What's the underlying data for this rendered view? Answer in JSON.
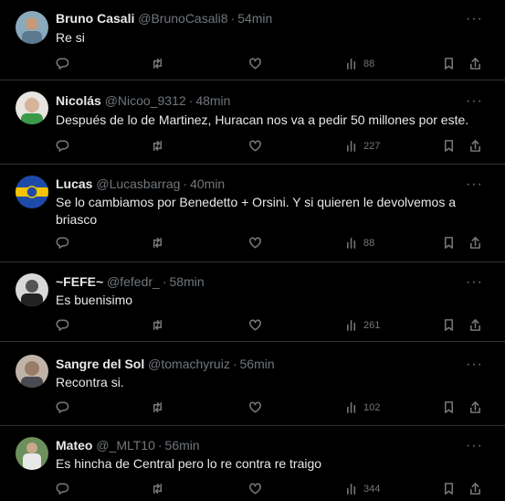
{
  "replies": [
    {
      "name": "Bruno Casali",
      "handle": "@BrunoCasali8",
      "time": "54min",
      "text": "Re si",
      "views": "88",
      "avatar_color": "#5b7a8f"
    },
    {
      "name": "Nicolás",
      "handle": "@Nicoo_9312",
      "time": "48min",
      "text": "Después de lo de Martinez,  Huracan nos va a pedir 50 millones por este.",
      "views": "227",
      "avatar_color": "#c9b3a0"
    },
    {
      "name": "Lucas",
      "handle": "@Lucasbarrag",
      "time": "40min",
      "text": "Se lo cambiamos por Benedetto + Orsini. Y si quieren le devolvemos a briasco",
      "views": "88",
      "avatar_color": "#1e4aa8"
    },
    {
      "name": "~FEFE~",
      "handle": "@fefedr_",
      "time": "58min",
      "text": "Es buenisimo",
      "views": "261",
      "avatar_color": "#3a3a3a"
    },
    {
      "name": "Sangre del Sol",
      "handle": "@tomachyruiz",
      "time": "56min",
      "text": "Recontra si.",
      "views": "102",
      "avatar_color": "#a08c7a"
    },
    {
      "name": "Mateo",
      "handle": "@_MLT10",
      "time": "56min",
      "text": "Es hincha de Central pero lo re contra re traigo",
      "views": "344",
      "avatar_color": "#3f7a3a"
    }
  ],
  "icons": {
    "reply": "reply-icon",
    "retweet": "retweet-icon",
    "like": "heart-icon",
    "views": "views-icon",
    "bookmark": "bookmark-icon",
    "share": "share-icon",
    "more": "more-icon"
  }
}
